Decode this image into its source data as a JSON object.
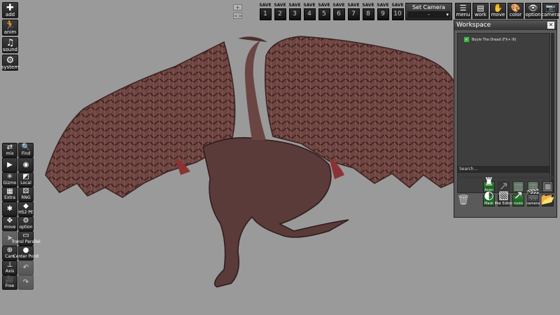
{
  "left_toolbar": {
    "top": [
      {
        "label": "add",
        "icon": "plus-icon"
      },
      {
        "label": "anim",
        "icon": "run-icon"
      },
      {
        "label": "sound",
        "icon": "music-icon"
      },
      {
        "label": "system",
        "icon": "gears-icon"
      }
    ],
    "bottom": [
      {
        "label": "mix",
        "icon": "mix-icon",
        "dim": false
      },
      {
        "label": "Find",
        "icon": "search-icon",
        "dim": false
      },
      {
        "label": "",
        "icon": "play-icon",
        "dim": false
      },
      {
        "label": "",
        "icon": "camera-lens-icon",
        "dim": false
      },
      {
        "label": "Gizmo",
        "icon": "gizmo-icon",
        "dim": false
      },
      {
        "label": "Local",
        "icon": "local-icon",
        "dim": false
      },
      {
        "label": "Extra",
        "icon": "extra-icon",
        "dim": false
      },
      {
        "label": "RNG",
        "icon": "dice-icon",
        "dim": false
      },
      {
        "label": "",
        "icon": "puzzle-icon",
        "dim": false
      },
      {
        "label": "HS2 PE",
        "icon": "hs2pe-icon",
        "dim": false
      },
      {
        "label": "move",
        "icon": "move-arrows-icon",
        "dim": false
      },
      {
        "label": "option",
        "icon": "gear-icon",
        "dim": false
      },
      {
        "label": "",
        "icon": "arrow-icon",
        "dim": true
      },
      {
        "label": "Transl Parallel",
        "icon": "parallel-icon",
        "dim": false
      },
      {
        "label": "Cam",
        "icon": "cam-plus-icon",
        "dim": false
      },
      {
        "label": "Center Point",
        "icon": "center-icon",
        "dim": false
      },
      {
        "label": "Axis",
        "icon": "axis-icon",
        "dim": false
      },
      {
        "label": "",
        "icon": "undo-icon",
        "dim": true
      },
      {
        "label": "Free",
        "icon": "free-cam-icon",
        "dim": false
      },
      {
        "label": "",
        "icon": "redo-icon",
        "dim": true
      }
    ]
  },
  "top_bar": {
    "mini_plus": "+",
    "mini_toggle": "<>",
    "save_label": "SAVE",
    "save_slots": [
      "1",
      "2",
      "3",
      "4",
      "5",
      "6",
      "7",
      "8",
      "9",
      "10"
    ],
    "set_camera": {
      "title": "Set Camera",
      "value": "-"
    },
    "buttons": [
      {
        "label": "menu",
        "icon": "menu-icon"
      },
      {
        "label": "work",
        "icon": "work-icon"
      },
      {
        "label": "move",
        "icon": "hand-icon"
      },
      {
        "label": "color",
        "icon": "color-icon"
      },
      {
        "label": "option",
        "icon": "eye-icon"
      },
      {
        "label": "camera",
        "icon": "camera-icon"
      }
    ]
  },
  "workspace": {
    "title": "Workspace",
    "items": [
      {
        "name": "Boyle The Dread (FX+ III)",
        "checked": true
      }
    ],
    "search_placeholder": "Search...",
    "buttons": [
      {
        "label": "Anim",
        "icon": "anim-icon",
        "green": true,
        "dim": false
      },
      {
        "label": "",
        "icon": "route-icon",
        "green": false,
        "dim": true
      },
      {
        "label": "",
        "icon": "grid-icon",
        "green": true,
        "dim": true
      },
      {
        "label": "",
        "icon": "grid-icon",
        "green": true,
        "dim": true
      },
      {
        "label": "",
        "icon": "film-icon",
        "green": false,
        "dim": true
      },
      {
        "label": "Mask",
        "icon": "mask-icon",
        "green": true,
        "dim": false
      },
      {
        "label": "Mat Editor",
        "icon": "mat-editor-icon",
        "green": false,
        "dim": false
      },
      {
        "label": "route",
        "icon": "route-icon",
        "green": true,
        "dim": false
      },
      {
        "label": "camera",
        "icon": "clapper-icon",
        "green": false,
        "dim": false
      },
      {
        "label": "",
        "icon": "folder-icon",
        "green": false,
        "dim": false
      }
    ]
  },
  "colors": {
    "viewport": "#9a9a9a",
    "toolbar": "#2a2a2a",
    "accent_green": "#2e7d32"
  }
}
